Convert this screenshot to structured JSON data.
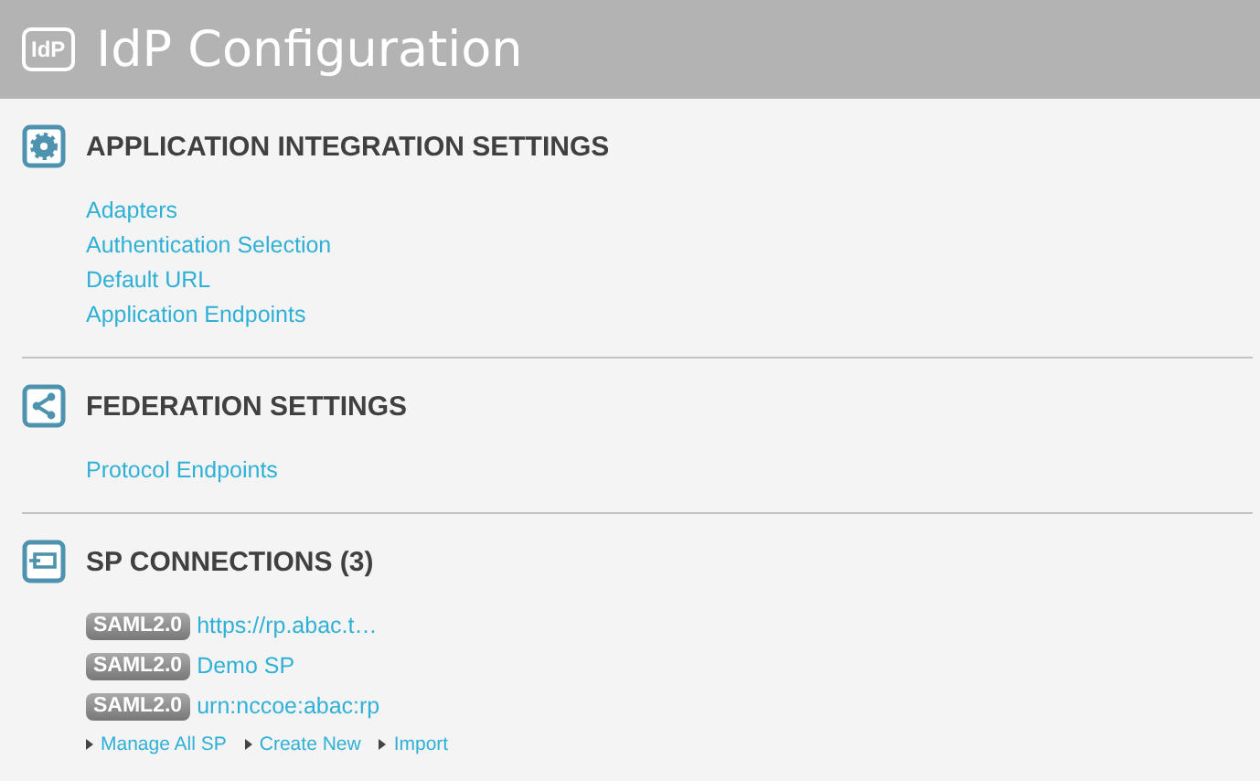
{
  "header": {
    "logo": "IdP",
    "title": "IdP Configuration"
  },
  "sections": [
    {
      "kind": "gear",
      "title": "APPLICATION INTEGRATION SETTINGS",
      "links": [
        "Adapters",
        "Authentication Selection",
        "Default URL",
        "Application Endpoints"
      ]
    },
    {
      "kind": "share",
      "title": "FEDERATION SETTINGS",
      "links": [
        "Protocol Endpoints"
      ]
    },
    {
      "kind": "screen",
      "title": "SP CONNECTIONS (3)",
      "connections": [
        {
          "badge": "SAML2.0",
          "name": "https://rp.abac.t…"
        },
        {
          "badge": "SAML2.0",
          "name": "Demo SP"
        },
        {
          "badge": "SAML2.0",
          "name": "urn:nccoe:abac:rp"
        }
      ],
      "actions": [
        "Manage All SP",
        "Create New",
        "Import"
      ]
    }
  ]
}
